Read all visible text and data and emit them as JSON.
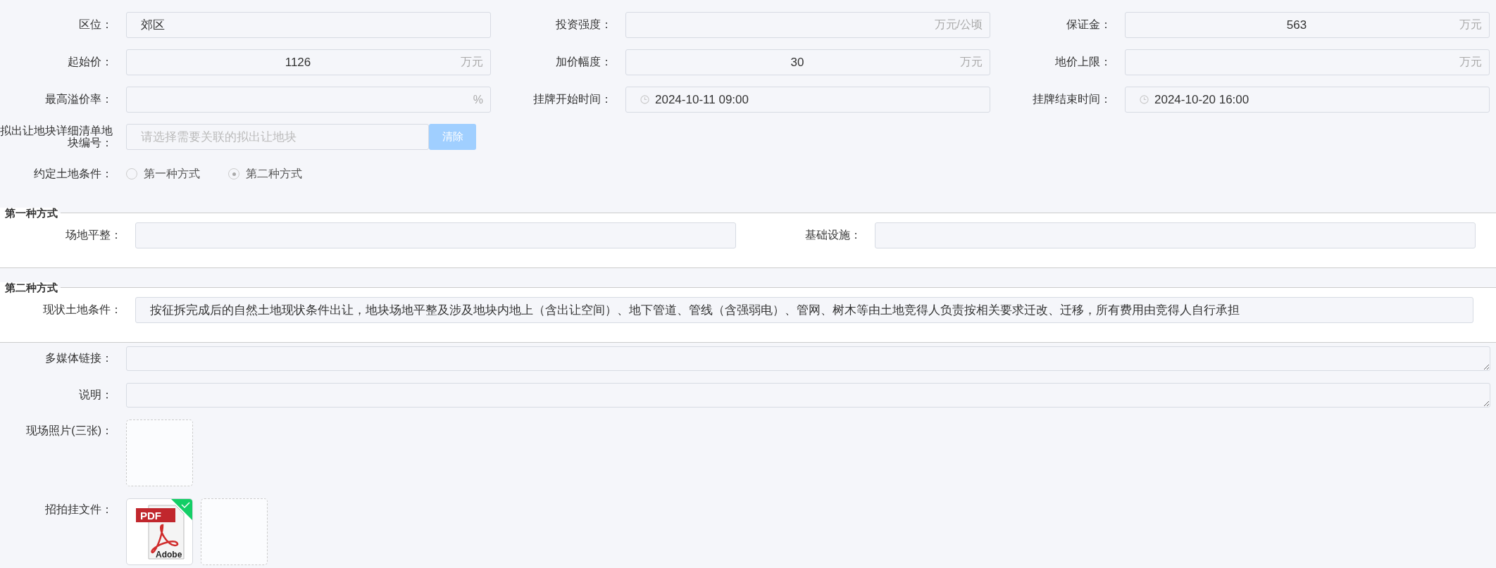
{
  "fields": [
    {
      "label": "区位：",
      "kind": "text",
      "value": "郊区"
    },
    {
      "label": "投资强度：",
      "kind": "number",
      "unit": "万元/公顷"
    },
    {
      "label": "保证金：",
      "kind": "number",
      "value": "563",
      "unit": "万元"
    },
    {
      "label": "起始价：",
      "kind": "number",
      "value": "1126",
      "unit": "万元"
    },
    {
      "label": "加价幅度：",
      "kind": "number",
      "value": "30",
      "unit": "万元"
    },
    {
      "label": "地价上限：",
      "kind": "number",
      "unit": "万元"
    },
    {
      "label": "最高溢价率：",
      "kind": "number",
      "unit": "%"
    },
    {
      "label": "挂牌开始时间：",
      "kind": "time",
      "value": "2024-10-11 09:00"
    },
    {
      "label": "挂牌结束时间：",
      "kind": "time",
      "value": "2024-10-20 16:00"
    }
  ],
  "parcel_select": {
    "label": "拟出让地块详细清单地块编号：",
    "placeholder": "请选择需要关联的拟出让地块",
    "button": "清除"
  },
  "land_condition": {
    "label": "约定土地条件：",
    "options": [
      {
        "label": "第一种方式",
        "selected": false
      },
      {
        "label": "第二种方式",
        "selected": true
      }
    ]
  },
  "sections": [
    {
      "title": "第一种方式",
      "fields": [
        {
          "label": "场地平整："
        },
        {
          "label": "基础设施："
        }
      ]
    },
    {
      "title": "第二种方式",
      "fields": [
        {
          "label": "现状土地条件：",
          "value": "按征拆完成后的自然土地现状条件出让，地块场地平整及涉及地块内地上（含出让空间）、地下管道、管线（含强弱电）、管网、树木等由土地竞得人负责按相关要求迁改、迁移，所有费用由竞得人自行承担"
        }
      ]
    }
  ],
  "textareas": [
    {
      "label": "多媒体链接："
    },
    {
      "label": "说明："
    }
  ],
  "uploads": [
    {
      "label": "现场照片(三张)：",
      "items": [
        {
          "kind": "empty"
        }
      ]
    },
    {
      "label": "招拍挂文件：",
      "items": [
        {
          "kind": "pdf",
          "uploaded": true,
          "badge": "PDF",
          "caption": "Adobe"
        },
        {
          "kind": "empty"
        }
      ]
    }
  ]
}
